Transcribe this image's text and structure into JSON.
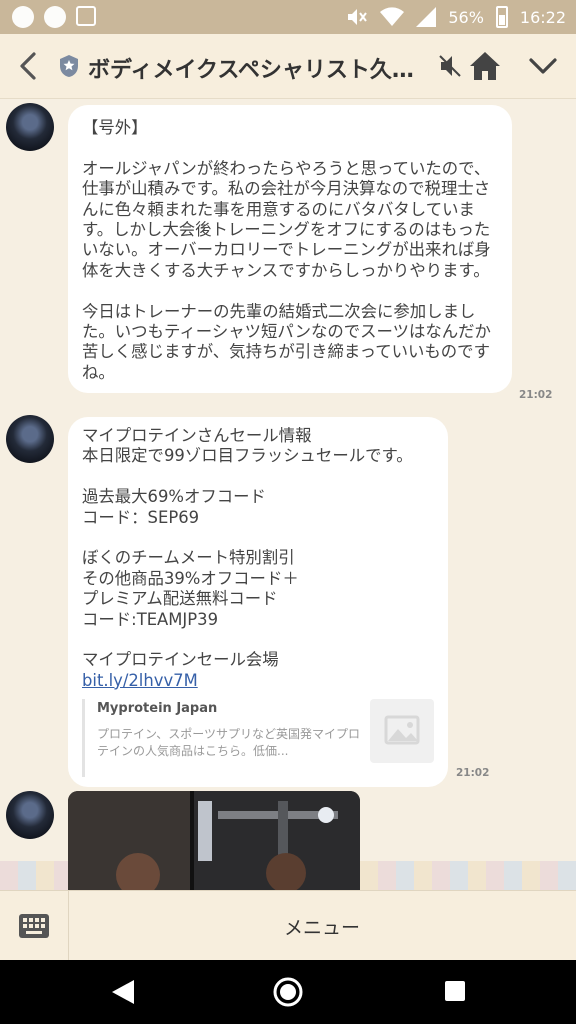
{
  "status_bar": {
    "battery": "56%",
    "time": "16:22"
  },
  "header": {
    "title": "ボディメイクスペシャリスト久野…"
  },
  "messages": [
    {
      "text": "【号外】\n\nオールジャパンが終わったらやろうと思っていたので、仕事が山積みです。私の会社が今月決算なので税理士さんに色々頼まれた事を用意するのにバタバタしています。しかし大会後トレーニングをオフにするのはもったいない。オーバーカロリーでトレーニングが出来れば身体を大きくする大チャンスですからしっかりやります。\n\n今日はトレーナーの先輩の結婚式二次会に参加しました。いつもティーシャツ短パンなのでスーツはなんだか苦しく感じますが、気持ちが引き締まっていいものですね。",
      "time": "21:02"
    },
    {
      "text": "マイプロテインさんセール情報\n本日限定で99ゾロ目フラッシュセールです。\n\n過去最大69%オフコード\nコード：SEP69\n\nぼくのチームメート特別割引\nその他商品39%オフコード＋\nプレミアム配送無料コード\nコード:TEAMJP39\n\nマイプロテインセール会場",
      "link": "bit.ly/2lhvv7M",
      "preview_title": "Myprotein Japan",
      "preview_desc": "プロテイン、スポーツサプリなど英国発マイプロテインの人気商品はこちら。低価...",
      "time": "21:02"
    }
  ],
  "bottom_bar": {
    "menu_label": "メニュー"
  },
  "colors": {
    "status_bar": "#c9b79a",
    "header_bg": "#f7eedd",
    "chat_bg": "#f6efe2",
    "bubble": "#ffffff",
    "link": "#3660a8"
  }
}
